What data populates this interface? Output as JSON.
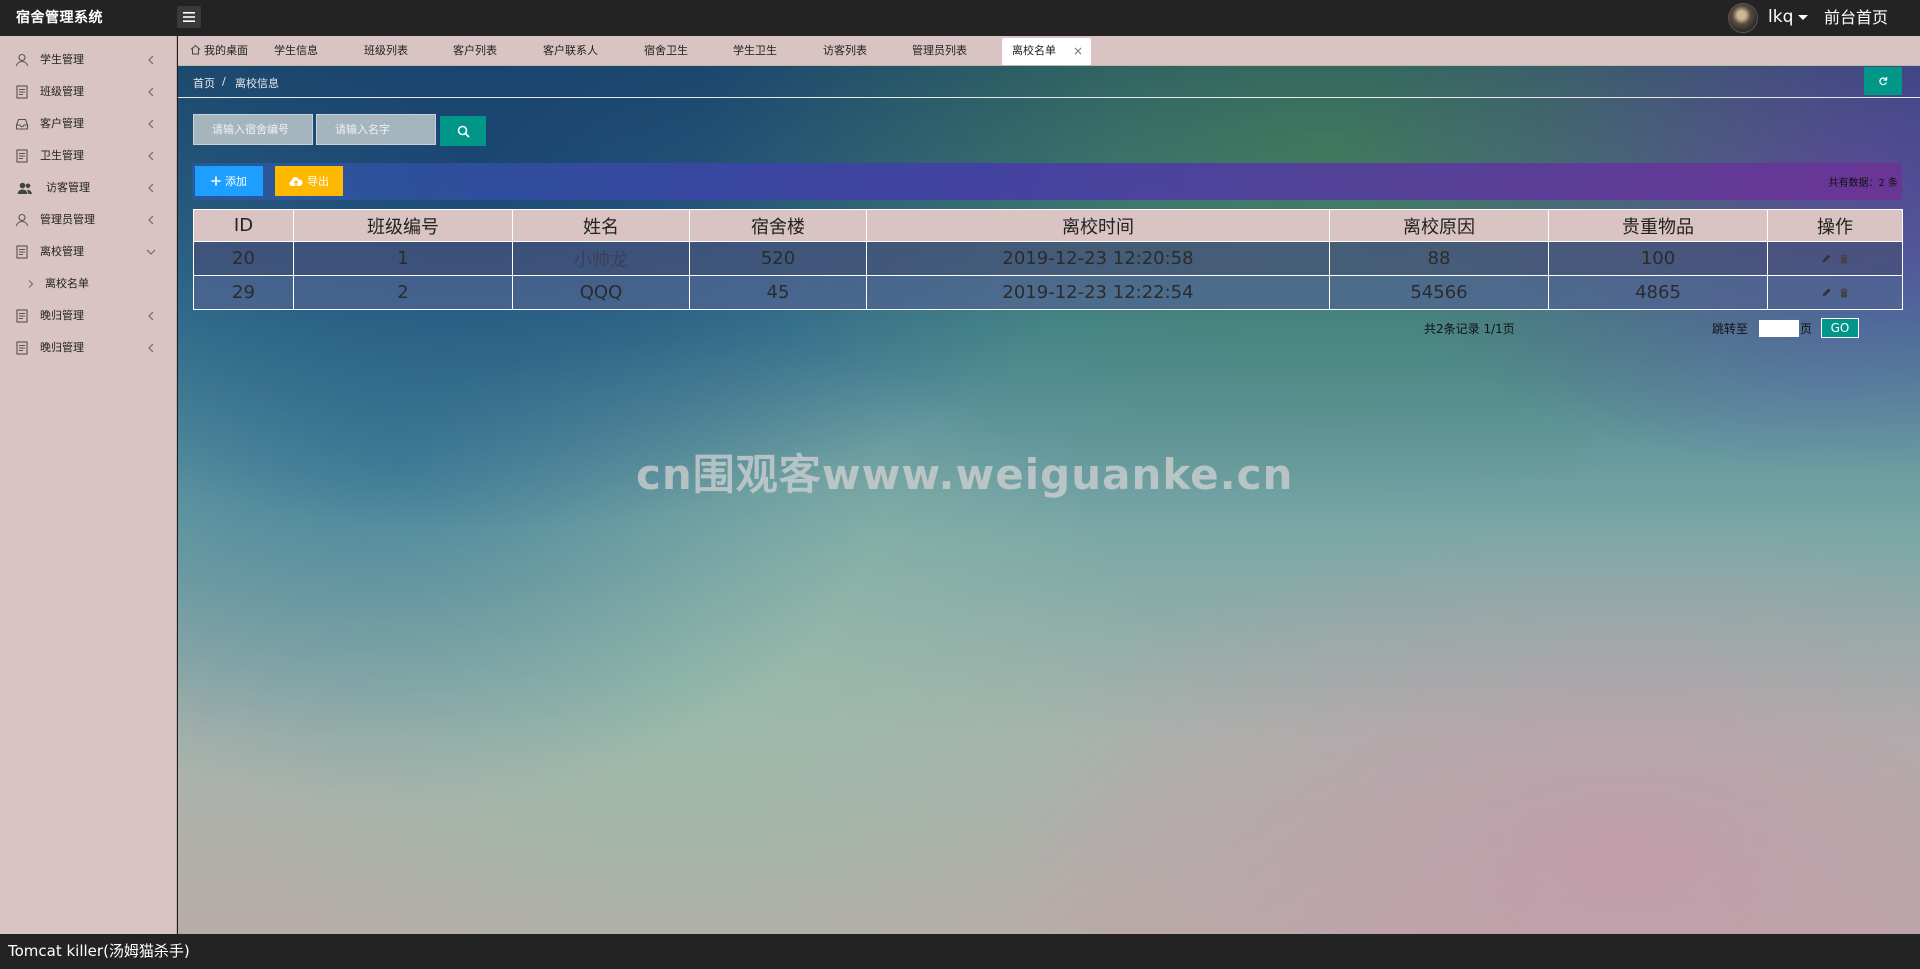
{
  "header": {
    "app_title": "宿舍管理系统",
    "user_name": "lkq",
    "front_home": "前台首页"
  },
  "sidebar": {
    "items": [
      {
        "label": "学生管理",
        "icon": "user-icon"
      },
      {
        "label": "班级管理",
        "icon": "document-icon"
      },
      {
        "label": "客户管理",
        "icon": "inbox-icon"
      },
      {
        "label": "卫生管理",
        "icon": "document-icon"
      },
      {
        "label": "访客管理",
        "icon": "users-icon"
      },
      {
        "label": "管理员管理",
        "icon": "user-icon"
      },
      {
        "label": "离校管理",
        "icon": "document-icon",
        "expanded": true
      },
      {
        "label": "离校名单",
        "icon": "chevron-right-icon",
        "submenu": true
      },
      {
        "label": "晚归管理",
        "icon": "document-icon"
      },
      {
        "label": "晚归管理",
        "icon": "document-icon"
      }
    ]
  },
  "tabs": [
    {
      "label": "我的桌面"
    },
    {
      "label": "学生信息"
    },
    {
      "label": "班级列表"
    },
    {
      "label": "客户列表"
    },
    {
      "label": "客户联系人"
    },
    {
      "label": "宿舍卫生"
    },
    {
      "label": "学生卫生"
    },
    {
      "label": "访客列表"
    },
    {
      "label": "管理员列表"
    },
    {
      "label": "离校名单",
      "active": true
    }
  ],
  "breadcrumb": {
    "home": "首页",
    "separator": "/",
    "current": "离校信息"
  },
  "search": {
    "dorm_placeholder": "请输入宿舍编号",
    "name_placeholder": "请输入名字"
  },
  "toolbar": {
    "add_label": "添加",
    "export_label": "导出",
    "total_text": "共有数据：2 条"
  },
  "table": {
    "columns": [
      "ID",
      "班级编号",
      "姓名",
      "宿舍楼",
      "离校时间",
      "离校原因",
      "贵重物品",
      "操作"
    ],
    "rows": [
      {
        "id": "20",
        "class_no": "1",
        "name": "小帅龙",
        "building": "520",
        "leave_time": "2019-12-23 12:20:58",
        "reason": "88",
        "valuables": "100"
      },
      {
        "id": "29",
        "class_no": "2",
        "name": "QQQ",
        "building": "45",
        "leave_time": "2019-12-23 12:22:54",
        "reason": "54566",
        "valuables": "4865"
      }
    ]
  },
  "pager": {
    "info": "共2条记录  1/1页",
    "jump_label": "跳转至",
    "page_unit": "页",
    "go_label": "GO"
  },
  "watermark": "cn围观客www.weiguanke.cn",
  "footer": {
    "text": "Tomcat killer(汤姆猫杀手)"
  },
  "colors": {
    "header_bg": "#232323",
    "sidebar_bg": "#d9c3c3",
    "teal": "#009688",
    "blue": "#1e9fff",
    "yellow": "#ffb800"
  }
}
